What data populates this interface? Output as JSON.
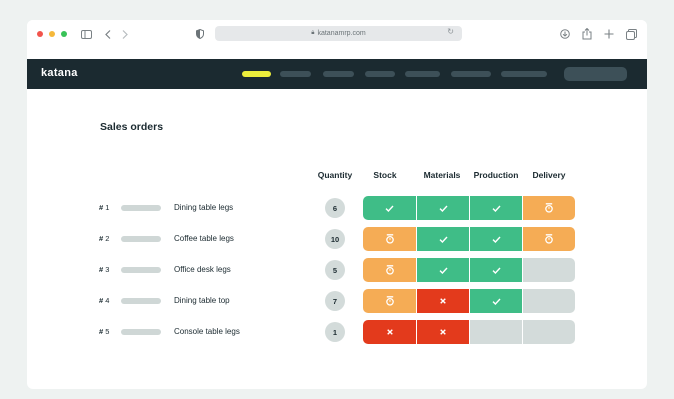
{
  "browser": {
    "url": "katanamrp.com",
    "traffic_light_colors": [
      "#f2544c",
      "#f5b83a",
      "#38c257"
    ],
    "icons": [
      "sidebar-icon",
      "back-icon",
      "forward-icon",
      "privacy-shield-icon",
      "download-icon",
      "share-icon",
      "new-tab-icon",
      "tabs-icon"
    ]
  },
  "app": {
    "logo": "katana",
    "nav_active_color": "#ecee3c",
    "nav_color": "#1b2a30"
  },
  "page": {
    "title": "Sales orders",
    "columns": {
      "quantity": "Quantity",
      "stock": "Stock",
      "materials": "Materials",
      "production": "Production",
      "delivery": "Delivery"
    }
  },
  "status_legend": {
    "ok": "#3fbd87",
    "wait": "#f5ac55",
    "no": "#e33a1c",
    "na": "#d3dbda"
  },
  "orders": [
    {
      "hash": "#",
      "num": "1",
      "name": "Dining table legs",
      "quantity": "6",
      "stock": "ok",
      "materials": "ok",
      "production": "ok",
      "delivery": "wait"
    },
    {
      "hash": "#",
      "num": "2",
      "name": "Coffee table legs",
      "quantity": "10",
      "stock": "wait",
      "materials": "ok",
      "production": "ok",
      "delivery": "wait"
    },
    {
      "hash": "#",
      "num": "3",
      "name": "Office desk legs",
      "quantity": "5",
      "stock": "wait",
      "materials": "ok",
      "production": "ok",
      "delivery": "na"
    },
    {
      "hash": "#",
      "num": "4",
      "name": "Dining table top",
      "quantity": "7",
      "stock": "wait",
      "materials": "no",
      "production": "ok",
      "delivery": "na"
    },
    {
      "hash": "#",
      "num": "5",
      "name": "Console table legs",
      "quantity": "1",
      "stock": "no",
      "materials": "no",
      "production": "na",
      "delivery": "na"
    }
  ]
}
